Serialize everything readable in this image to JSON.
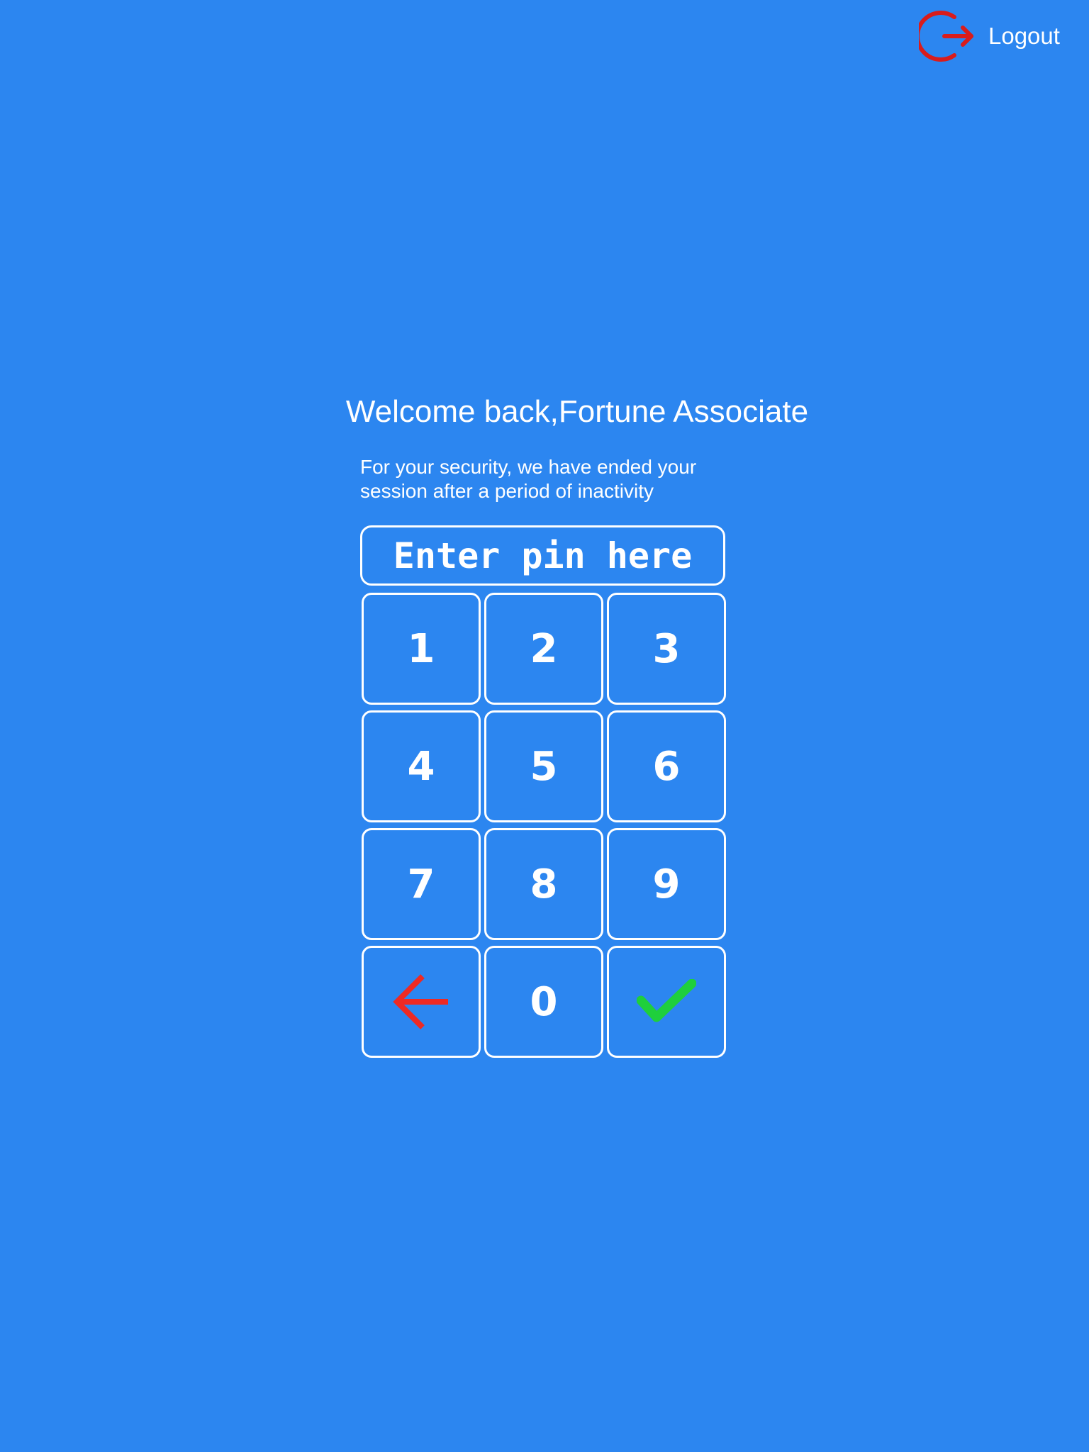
{
  "header": {
    "logout_label": "Logout",
    "logout_icon": "logout-icon",
    "logout_icon_color": "#d91c1c"
  },
  "main": {
    "welcome_title": "Welcome back,Fortune Associate",
    "session_message_line1": "For your security, we have ended your",
    "session_message_line2": "session after a period of inactivity",
    "pin_input": {
      "value": "",
      "placeholder": "Enter pin here"
    }
  },
  "keypad": {
    "keys": [
      "1",
      "2",
      "3",
      "4",
      "5",
      "6",
      "7",
      "8",
      "9"
    ],
    "zero_label": "0",
    "backspace_icon": "arrow-left-icon",
    "backspace_color": "#ee2a24",
    "submit_icon": "checkmark-icon",
    "submit_color": "#1fcf3c"
  },
  "colors": {
    "background": "#2c86f0",
    "foreground": "#ffffff"
  }
}
